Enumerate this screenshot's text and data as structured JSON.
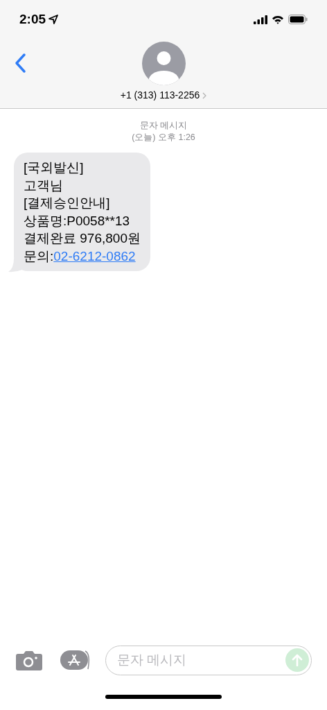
{
  "status_bar": {
    "time": "2:05"
  },
  "header": {
    "contact": "+1 (313) 113-2256"
  },
  "thread": {
    "service": "문자 메시지",
    "timestamp": "(오늘) 오후 1:26"
  },
  "message": {
    "lines": [
      "[국외발신]",
      "고객님",
      "[결제승인안내]",
      "상품명:P0058**13",
      "결제완료 976,800원"
    ],
    "inquiry_label": "문의:",
    "link": "02-6212-0862"
  },
  "composer": {
    "placeholder": "문자 메시지",
    "send_enabled": false
  }
}
